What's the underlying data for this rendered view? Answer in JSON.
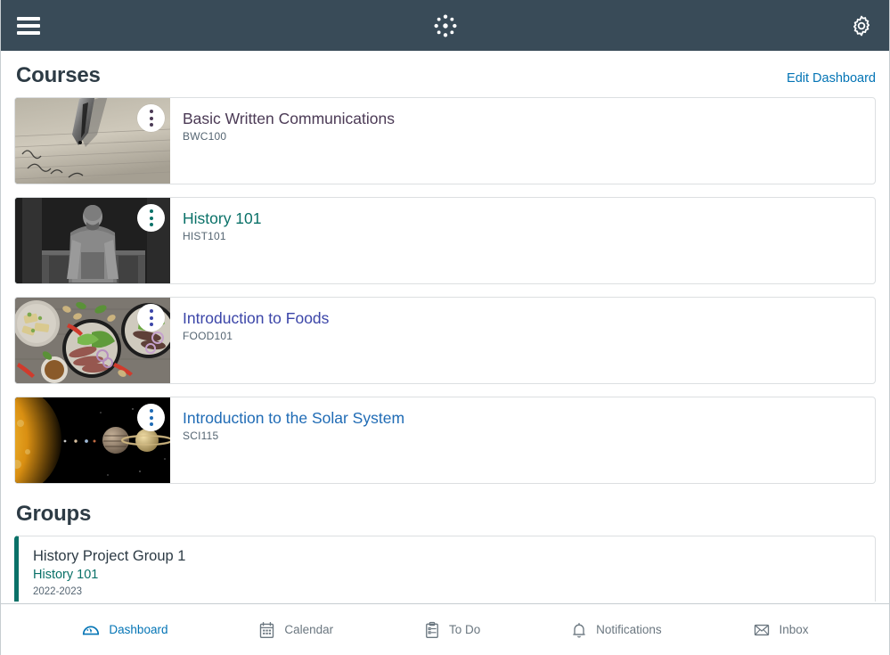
{
  "topbar": {
    "menu_icon": "hamburger-menu-icon",
    "brand_icon": "canvas-logo-icon",
    "settings_icon": "gear-icon"
  },
  "courses_section": {
    "title": "Courses",
    "edit_link": "Edit Dashboard"
  },
  "courses": [
    {
      "name": "Basic Written Communications",
      "code": "BWC100",
      "color": "#4B3A55",
      "kebab_color": "#4B3A55",
      "image": "fountain-pen-writing"
    },
    {
      "name": "History 101",
      "code": "HIST101",
      "color": "#0a7168",
      "kebab_color": "#0a7168",
      "image": "lincoln-memorial-statue"
    },
    {
      "name": "Introduction to Foods",
      "code": "FOOD101",
      "color": "#3B45A8",
      "kebab_color": "#3B45A8",
      "image": "food-flat-lay"
    },
    {
      "name": "Introduction to the Solar System",
      "code": "SCI115",
      "color": "#1F6BB5",
      "kebab_color": "#1F6BB5",
      "image": "solar-system-planets"
    }
  ],
  "groups_section": {
    "title": "Groups"
  },
  "groups": [
    {
      "name": "History Project Group 1",
      "course": "History 101",
      "term": "2022-2023",
      "accent": "#0a7168"
    }
  ],
  "bottom_nav": [
    {
      "label": "Dashboard",
      "icon": "dashboard-gauge-icon",
      "active": true
    },
    {
      "label": "Calendar",
      "icon": "calendar-icon",
      "active": false
    },
    {
      "label": "To Do",
      "icon": "clipboard-list-icon",
      "active": false
    },
    {
      "label": "Notifications",
      "icon": "bell-icon",
      "active": false
    },
    {
      "label": "Inbox",
      "icon": "envelope-icon",
      "active": false
    }
  ],
  "theme": {
    "topbar_bg": "#394B58",
    "link_blue": "#0374B5",
    "text_dark": "#2D3B45",
    "text_muted": "#556572"
  }
}
